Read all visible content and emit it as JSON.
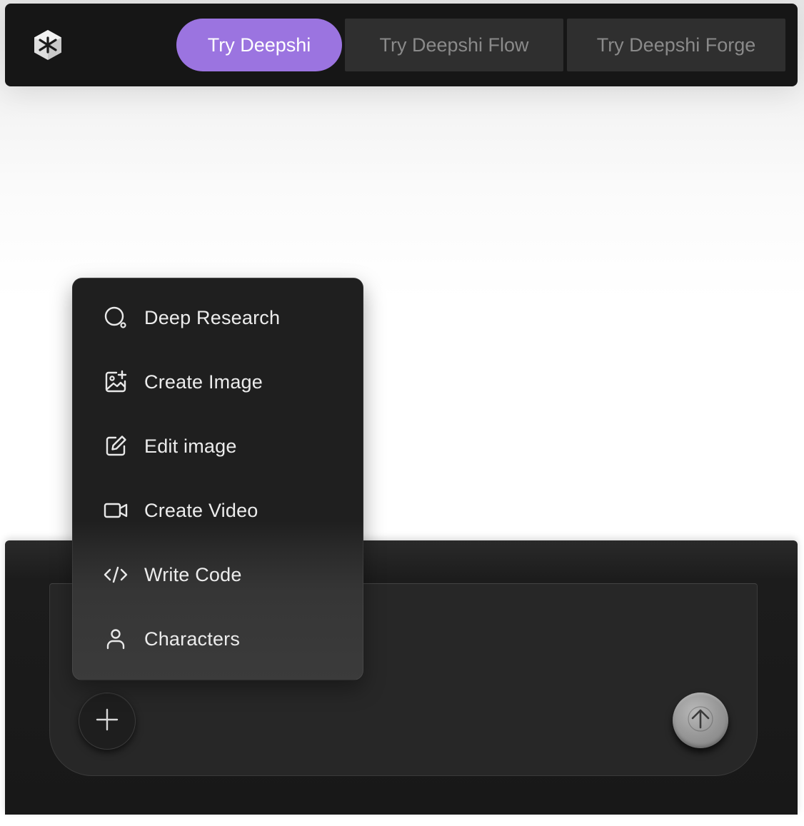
{
  "nav": {
    "primary_label": "Try Deepshi",
    "flow_label": "Try Deepshi Flow",
    "forge_label": "Try Deepshi Forge"
  },
  "menu": {
    "items": [
      {
        "label": "Deep Research",
        "icon": "search-icon"
      },
      {
        "label": "Create Image",
        "icon": "image-plus-icon"
      },
      {
        "label": "Edit image",
        "icon": "edit-icon"
      },
      {
        "label": "Create Video",
        "icon": "video-icon"
      },
      {
        "label": "Write Code",
        "icon": "code-icon"
      },
      {
        "label": "Characters",
        "icon": "user-icon"
      }
    ]
  },
  "composer": {
    "attach_icon": "plus-icon",
    "send_icon": "arrow-up-icon"
  },
  "colors": {
    "accent": "#9b74e0",
    "topbar_bg": "#161616",
    "menu_bg": "#1f1f1f",
    "composer_bg": "#272727"
  }
}
